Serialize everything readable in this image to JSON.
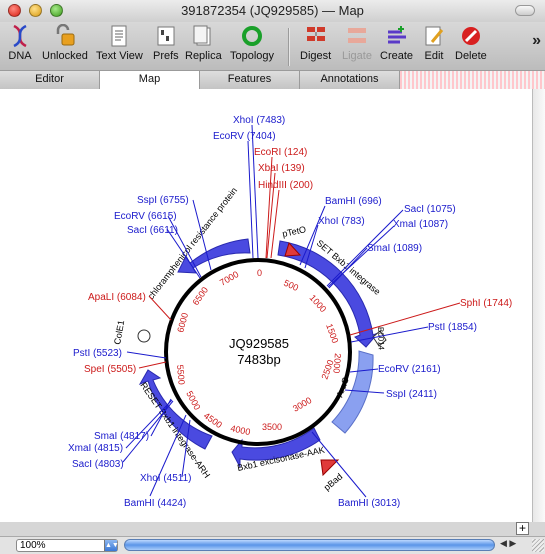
{
  "window": {
    "title": "391872354 (JQ929585) — Map"
  },
  "toolbar": {
    "dna": "DNA",
    "unlocked": "Unlocked",
    "text_view": "Text View",
    "prefs": "Prefs",
    "replica": "Replica",
    "topology": "Topology",
    "digest": "Digest",
    "ligate": "Ligate",
    "create": "Create",
    "edit": "Edit",
    "delete": "Delete"
  },
  "tabs": {
    "editor": "Editor",
    "map": "Map",
    "features": "Features",
    "annotations": "Annotations"
  },
  "map": {
    "name": "JQ929585",
    "length": "7483bp",
    "ticks": [
      "0",
      "500",
      "1000",
      "1500",
      "2000",
      "2500",
      "3000",
      "3500",
      "4000",
      "4500",
      "5000",
      "5500",
      "6000",
      "6500",
      "7000"
    ],
    "sites": [
      {
        "label": "XhoI (7483)",
        "color": "#1a1acc"
      },
      {
        "label": "EcoRV (7404)",
        "color": "#1a1acc"
      },
      {
        "label": "EcoRI (124)",
        "color": "#cc1a1a"
      },
      {
        "label": "XbaI (139)",
        "color": "#cc1a1a"
      },
      {
        "label": "HindIII (200)",
        "color": "#cc1a1a"
      },
      {
        "label": "BamHI (696)",
        "color": "#1a1acc"
      },
      {
        "label": "XhoI (783)",
        "color": "#1a1acc"
      },
      {
        "label": "SacI (1075)",
        "color": "#1a1acc"
      },
      {
        "label": "XmaI (1087)",
        "color": "#1a1acc"
      },
      {
        "label": "SmaI (1089)",
        "color": "#1a1acc"
      },
      {
        "label": "SphI (1744)",
        "color": "#cc1a1a"
      },
      {
        "label": "PstI (1854)",
        "color": "#1a1acc"
      },
      {
        "label": "EcoRV (2161)",
        "color": "#1a1acc"
      },
      {
        "label": "SspI (2411)",
        "color": "#1a1acc"
      },
      {
        "label": "BamHI (3013)",
        "color": "#1a1acc"
      },
      {
        "label": "BamHI (4424)",
        "color": "#1a1acc"
      },
      {
        "label": "XhoI (4511)",
        "color": "#1a1acc"
      },
      {
        "label": "SacI (4803)",
        "color": "#1a1acc"
      },
      {
        "label": "XmaI (4815)",
        "color": "#1a1acc"
      },
      {
        "label": "SmaI (4817)",
        "color": "#1a1acc"
      },
      {
        "label": "SpeI (5505)",
        "color": "#cc1a1a"
      },
      {
        "label": "PstI (5523)",
        "color": "#1a1acc"
      },
      {
        "label": "ApaLI (6084)",
        "color": "#cc1a1a"
      },
      {
        "label": "SacI (6611)",
        "color": "#1a1acc"
      },
      {
        "label": "EcoRV (6615)",
        "color": "#1a1acc"
      },
      {
        "label": "SspI (6755)",
        "color": "#1a1acc"
      }
    ],
    "features": {
      "ptet": "pTetO",
      "set": "SET Bxb1 integrase",
      "b0014": "B0014",
      "arac": "AraC",
      "xis": "Bxb1 excisonase-AAK",
      "pbad": "pBad",
      "reset": "RESET Bxb1 integrase-ARH",
      "cole1": "ColE1",
      "cat": "chloramphenicol resistance protein"
    }
  },
  "status": {
    "zoom": "100%"
  }
}
